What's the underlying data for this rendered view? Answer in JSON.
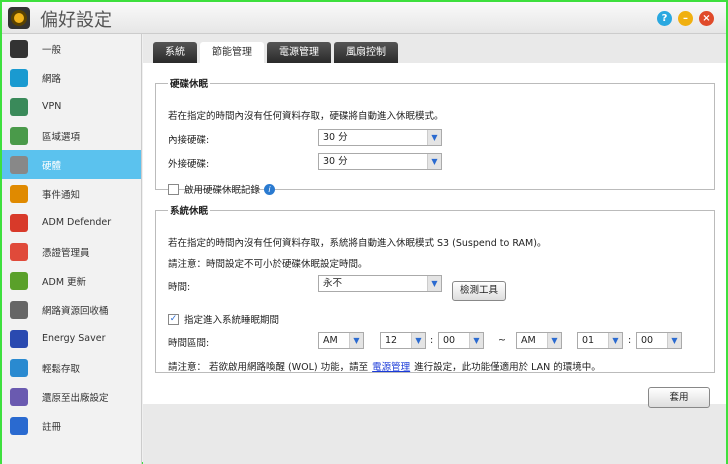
{
  "title": "偏好設定",
  "sidebar": {
    "items": [
      {
        "label": "一般",
        "color": "#333"
      },
      {
        "label": "網路",
        "color": "#1a9ad0"
      },
      {
        "label": "VPN",
        "color": "#3a8a5a"
      },
      {
        "label": "區域選項",
        "color": "#4a9a4a"
      },
      {
        "label": "硬體",
        "color": "#888"
      },
      {
        "label": "事件通知",
        "color": "#e08a00"
      },
      {
        "label": "ADM Defender",
        "color": "#d83a2a"
      },
      {
        "label": "憑證管理員",
        "color": "#e04a3a"
      },
      {
        "label": "ADM 更新",
        "color": "#5aa02a"
      },
      {
        "label": "網路資源回收桶",
        "color": "#666"
      },
      {
        "label": "Energy Saver",
        "color": "#2a4ab0"
      },
      {
        "label": "輕鬆存取",
        "color": "#2a8ad0"
      },
      {
        "label": "還原至出廠設定",
        "color": "#6a5ab0"
      },
      {
        "label": "註冊",
        "color": "#2a6ad0"
      }
    ],
    "selected": 4
  },
  "tabs": [
    "系統",
    "節能管理",
    "電源管理",
    "風扇控制"
  ],
  "hdd": {
    "legend": "硬碟休眠",
    "desc": "若在指定的時間內沒有任何資料存取，硬碟將自動進入休眠模式。",
    "internal_label": "內接硬碟:",
    "internal_value": "30 分",
    "external_label": "外接硬碟:",
    "external_value": "30 分",
    "log_label": "啟用硬碟休眠記錄"
  },
  "sys": {
    "legend": "系統休眠",
    "desc": "若在指定的時間內沒有任何資料存取，系統將自動進入休眠模式 S3 (Suspend to RAM)。",
    "note": "請注意：時間設定不可小於硬碟休眠設定時間。",
    "time_label": "時間:",
    "time_value": "永不",
    "detect_button": "檢測工具",
    "period_label": "指定進入系統睡眠期間",
    "range_label": "時間區間:",
    "start_ampm": "AM",
    "start_hour": "12",
    "start_min": "00",
    "tilde": "~",
    "end_ampm": "AM",
    "end_hour": "01",
    "end_min": "00",
    "colon": ":",
    "wol_prefix": "請注意： 若欲啟用網路喚醒 (WOL) 功能，請至",
    "wol_link": "電源管理",
    "wol_suffix": "進行設定，此功能僅適用於 LAN 的環境中。"
  },
  "apply": "套用"
}
